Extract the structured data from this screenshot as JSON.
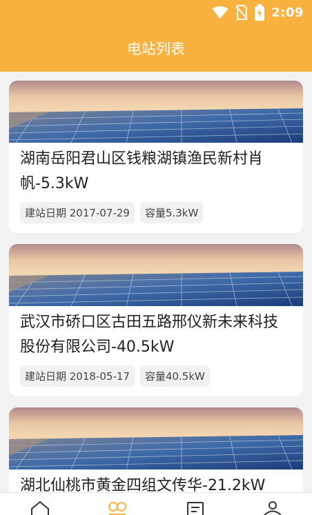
{
  "status_bar": {
    "time": "2:09",
    "icons": [
      "wifi-icon",
      "no-sim-icon",
      "battery-charging-icon"
    ]
  },
  "app_bar": {
    "title": "电站列表"
  },
  "stations": [
    {
      "title": "湖南岳阳君山区钱粮湖镇渔民新村肖帆-5.3kW",
      "build_date": "建站日期 2017-07-29",
      "capacity": "容量5.3kW"
    },
    {
      "title": "武汉市硚口区古田五路邢仪新未来科技股份有限公司-40.5kW",
      "build_date": "建站日期 2018-05-17",
      "capacity": "容量40.5kW"
    },
    {
      "title": "湖北仙桃市黄金四组文传华-21.2kW"
    }
  ],
  "tab_bar": {
    "tabs": [
      {
        "icon": "home-icon"
      },
      {
        "icon": "stations-icon",
        "active": true
      },
      {
        "icon": "report-icon"
      },
      {
        "icon": "profile-icon"
      }
    ],
    "active_color": "#f9b13f",
    "inactive_color": "#333333"
  },
  "colors": {
    "accent": "#f9b13f",
    "background": "#f2f2f2"
  }
}
